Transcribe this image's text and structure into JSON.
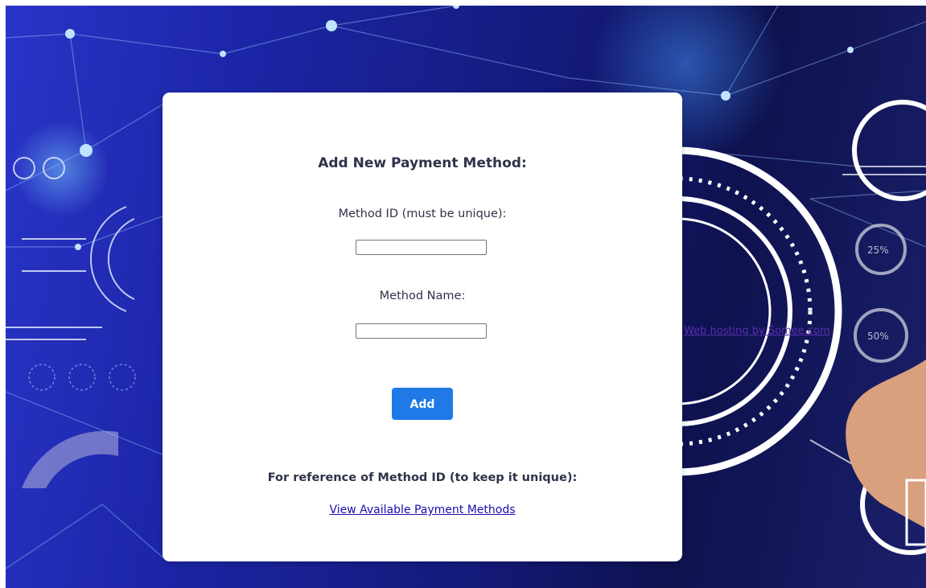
{
  "form": {
    "title": "Add New Payment Method:",
    "method_id_label": "Method ID (must be unique):",
    "method_id_value": "",
    "method_name_label": "Method Name:",
    "method_name_value": "",
    "add_button_label": "Add",
    "reference_text": "For reference of Method ID (to keep it unique):",
    "reference_link": "View Available Payment Methods"
  },
  "background": {
    "credit_link": "Web hosting by Somee.com",
    "gauge_top": "25%",
    "gauge_bottom": "50%"
  },
  "colors": {
    "button": "#1f7ae8",
    "link": "#1a0dab",
    "background_dark": "#141a7a"
  }
}
